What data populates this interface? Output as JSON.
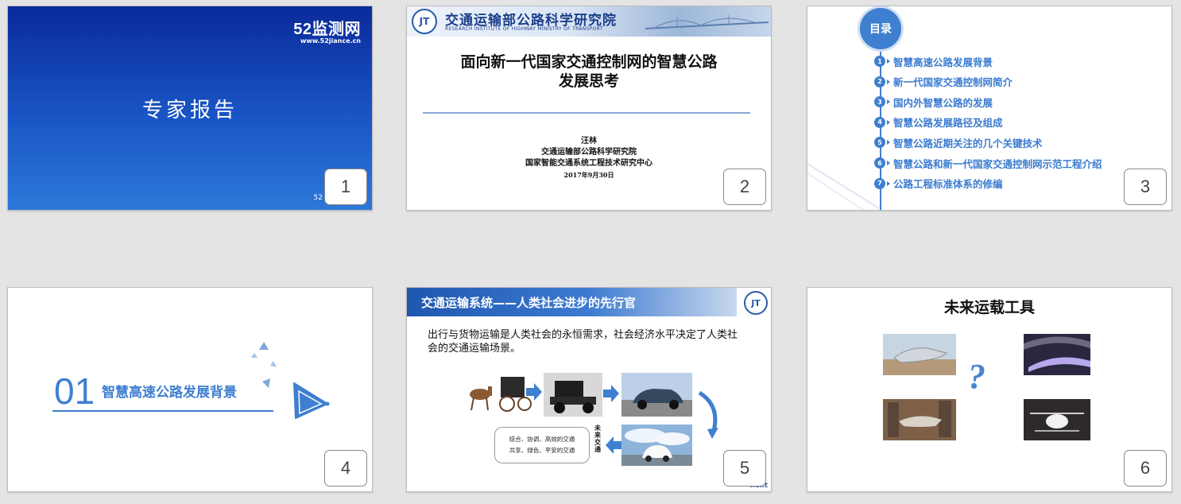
{
  "slides": [
    {
      "number": "1",
      "logo": "52监测网",
      "logo_url": "www.52jiance.cn",
      "title": "专家报告",
      "corner_text": "52"
    },
    {
      "number": "2",
      "org_name": "交通运输部公路科学研究院",
      "org_name_en": "RESEARCH INSTITUTE OF HIGHWAY MINISTRY OF TRANSPORT",
      "emblem": "JT",
      "title_line1": "面向新一代国家交通控制网的智慧公路",
      "title_line2": "发展思考",
      "author": "汪林",
      "affiliation1": "交通运输部公路科学研究院",
      "affiliation2": "国家智能交通系统工程技术研究中心",
      "date": "2017年9月30日"
    },
    {
      "number": "3",
      "badge": "目录",
      "items": [
        {
          "n": "1",
          "label": "智慧高速公路发展背景"
        },
        {
          "n": "2",
          "label": "新一代国家交通控制网简介"
        },
        {
          "n": "3",
          "label": "国内外智慧公路的发展"
        },
        {
          "n": "4",
          "label": "智慧公路发展路径及组成"
        },
        {
          "n": "5",
          "label": "智慧公路近期关注的几个关键技术"
        },
        {
          "n": "6",
          "label": "智慧公路和新一代国家交通控制网示范工程介绍"
        },
        {
          "n": "7",
          "label": "公路工程标准体系的修编"
        }
      ]
    },
    {
      "number": "4",
      "section_num": "01",
      "section_label": "智慧高速公路发展背景"
    },
    {
      "number": "5",
      "header": "交通运输系统——人类社会进步的先行官",
      "emblem": "JT",
      "body": "出行与货物运输是人类社会的永恒需求，社会经济水平决定了人类社会的交通运输场景。",
      "note_line1": "综合、协调、高效的交通",
      "note_line2": "共享、绿色、平安的交通",
      "vertical_label": "未来交通",
      "corner": "next"
    },
    {
      "number": "6",
      "title": "未来运载工具",
      "question": "?"
    }
  ],
  "colors": {
    "background": "#e4e4e4",
    "accent": "#3f7fd0",
    "slide1_bg": "#1a56c6"
  }
}
